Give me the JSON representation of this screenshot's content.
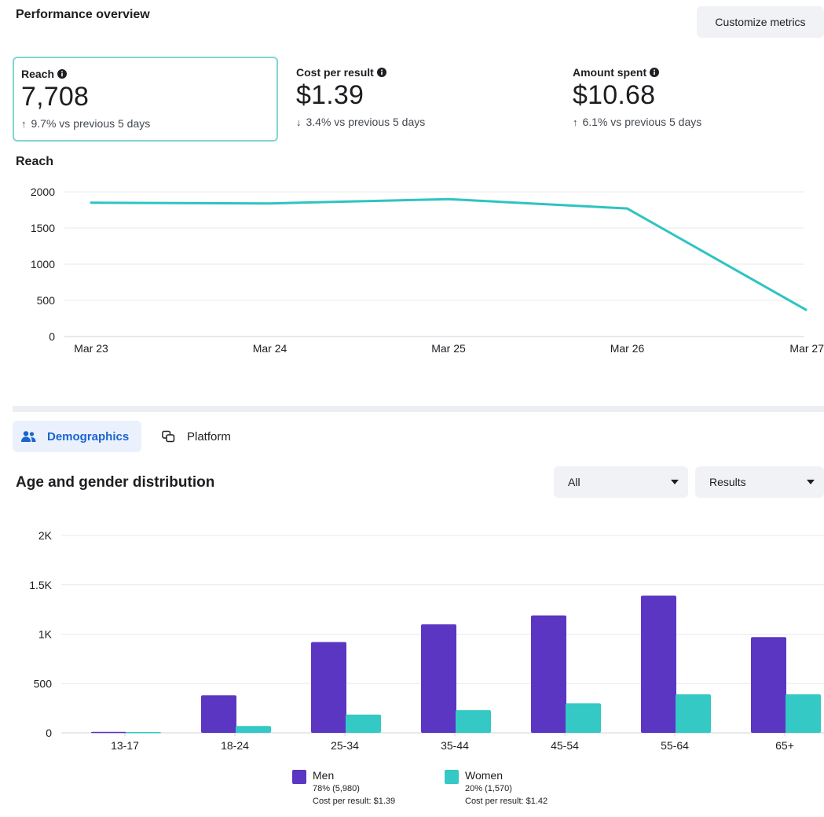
{
  "header": {
    "title": "Performance overview",
    "customize_label": "Customize metrics"
  },
  "metrics": [
    {
      "label": "Reach",
      "value": "7,708",
      "direction": "up",
      "change": "9.7% vs previous 5 days"
    },
    {
      "label": "Cost per result",
      "value": "$1.39",
      "direction": "down",
      "change": "3.4% vs previous 5 days"
    },
    {
      "label": "Amount spent",
      "value": "$10.68",
      "direction": "up",
      "change": "6.1% vs previous 5 days"
    }
  ],
  "arrows": {
    "up": "↑",
    "down": "↓"
  },
  "tabs": {
    "demographics": "Demographics",
    "platform": "Platform"
  },
  "demographics": {
    "title": "Age and gender distribution",
    "filter_selected": "All",
    "metric_selected": "Results"
  },
  "colors": {
    "accent": "#2ec4c0",
    "men": "#5b36c2",
    "women": "#34c9c5",
    "tab_active": "#1b64d0"
  },
  "legend": [
    {
      "name": "Men",
      "share": "78% (5,980)",
      "cost": "Cost per result: $1.39"
    },
    {
      "name": "Women",
      "share": "20% (1,570)",
      "cost": "Cost per result: $1.42"
    }
  ],
  "chart_data": [
    {
      "type": "line",
      "title": "Reach",
      "x": [
        "Mar 23",
        "Mar 24",
        "Mar 25",
        "Mar 26",
        "Mar 27"
      ],
      "series": [
        {
          "values": [
            1850,
            1840,
            1900,
            1770,
            370
          ]
        }
      ],
      "y_ticks": [
        "0",
        "500",
        "1000",
        "1500",
        "2000"
      ],
      "ylim": [
        0,
        2000
      ],
      "grid": true
    },
    {
      "type": "bar",
      "title": "Age and gender distribution",
      "categories": [
        "13-17",
        "18-24",
        "25-34",
        "35-44",
        "45-54",
        "55-64",
        "65+"
      ],
      "series": [
        {
          "name": "Men",
          "values": [
            10,
            380,
            920,
            1100,
            1190,
            1390,
            970
          ]
        },
        {
          "name": "Women",
          "values": [
            8,
            70,
            185,
            230,
            300,
            390,
            390
          ]
        }
      ],
      "y_ticks": [
        "0",
        "500",
        "1K",
        "1.5K",
        "2K"
      ],
      "ylim": [
        0,
        2000
      ],
      "legend": "bottom",
      "grid": true
    }
  ]
}
